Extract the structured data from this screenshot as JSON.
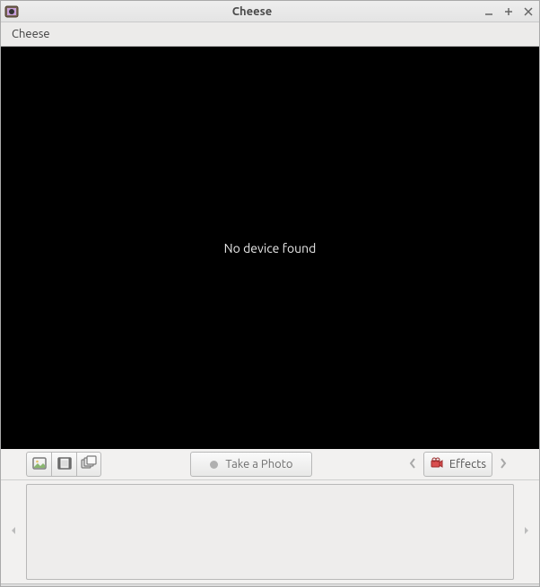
{
  "window": {
    "title": "Cheese"
  },
  "menubar": {
    "items": [
      {
        "label": "Cheese"
      }
    ]
  },
  "preview": {
    "message": "No device found"
  },
  "toolbar": {
    "take_photo_label": "Take a Photo",
    "effects_label": "Effects"
  }
}
